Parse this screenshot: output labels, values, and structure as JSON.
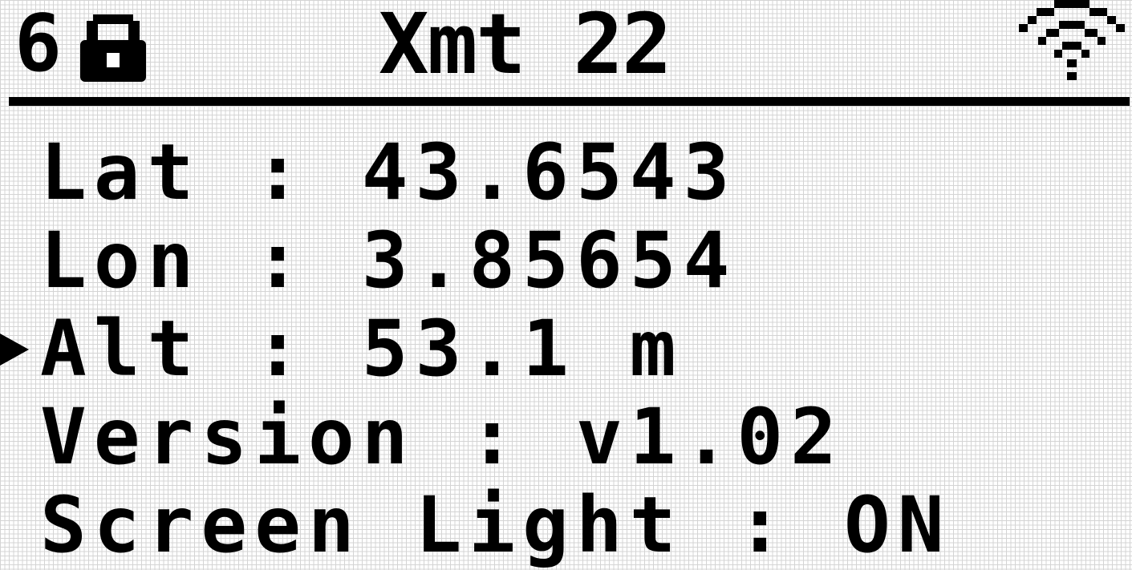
{
  "header": {
    "satellites": "6",
    "lock_icon": "lock-icon",
    "title": "Xmt 22",
    "signal_icon": "wifi-icon"
  },
  "menu": {
    "selected_index": 2,
    "items": [
      {
        "label": "Lat : 43.6543"
      },
      {
        "label": "Lon : 3.85654"
      },
      {
        "label": "Alt : 53.1 m"
      },
      {
        "label": "Version : v1.02"
      },
      {
        "label": "Screen Light : ON"
      }
    ]
  }
}
